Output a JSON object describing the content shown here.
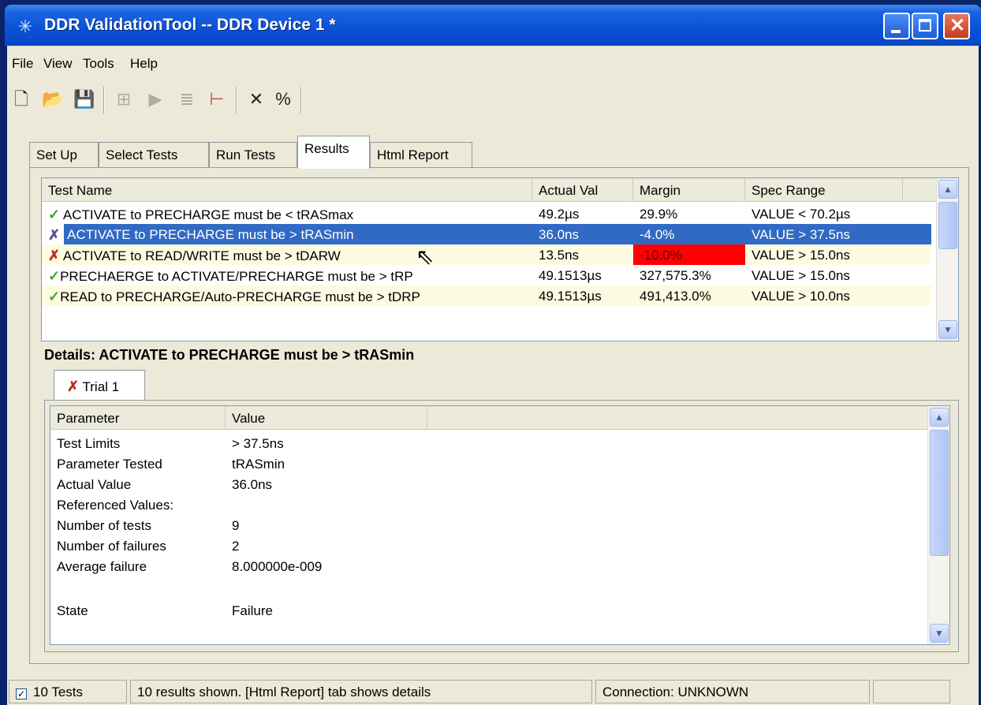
{
  "window": {
    "title": "DDR ValidationTool -- DDR Device 1 *",
    "icon": "app-sparkle-icon"
  },
  "menu": [
    "File",
    "View",
    "Tools",
    "Help"
  ],
  "toolbar": [
    "new-icon",
    "open-icon",
    "save-icon",
    "connect-icon",
    "run-icon",
    "step-icon",
    "marker-icon",
    "delete-icon",
    "percent-icon"
  ],
  "tabs": [
    {
      "label": "Set Up"
    },
    {
      "label": "Select Tests"
    },
    {
      "label": "Run Tests"
    },
    {
      "label": "Results",
      "active": true
    },
    {
      "label": "Html Report"
    }
  ],
  "results": {
    "columns": [
      "Test Name",
      "Actual Val",
      "Margin",
      "Spec Range"
    ],
    "rows": [
      {
        "status": "pass",
        "name": "ACTIVATE to PRECHARGE must be < tRASmax",
        "actual": "49.2µs",
        "margin": "29.9%",
        "spec": "VALUE < 70.2µs"
      },
      {
        "status": "fail",
        "name": "ACTIVATE to PRECHARGE must be > tRASmin",
        "actual": "36.0ns",
        "margin": "-4.0%",
        "spec": "VALUE > 37.5ns",
        "selected": true
      },
      {
        "status": "fail",
        "name": "ACTIVATE to READ/WRITE must be > tDARW",
        "actual": "13.5ns",
        "margin": "-10.0%",
        "spec": "VALUE > 15.0ns",
        "margin_highlight": true
      },
      {
        "status": "pass",
        "name": "PRECHAERGE to ACTIVATE/PRECHARGE must be > tRP",
        "actual": "49.1513µs",
        "margin": "327,575.3%",
        "spec": "VALUE > 15.0ns"
      },
      {
        "status": "pass",
        "name": "READ to PRECHARGE/Auto-PRECHARGE must be > tDRP",
        "actual": "49.1513µs",
        "margin": "491,413.0%",
        "spec": "VALUE > 10.0ns"
      }
    ]
  },
  "details": {
    "title": "Details: ACTIVATE to PRECHARGE must be > tRASmin",
    "trial_tab": "Trial 1",
    "columns": [
      "Parameter",
      "Value"
    ],
    "params": [
      {
        "name": "Test Limits",
        "value": "> 37.5ns"
      },
      {
        "name": "Parameter Tested",
        "value": "tRASmin"
      },
      {
        "name": "Actual Value",
        "value": "36.0ns"
      },
      {
        "name": "Referenced Values:",
        "value": ""
      },
      {
        "name": "Number of tests",
        "value": "9"
      },
      {
        "name": "Number of failures",
        "value": "2"
      },
      {
        "name": "Average failure",
        "value": "8.000000e-009"
      },
      {
        "name": "",
        "value": ""
      },
      {
        "name": "State",
        "value": "Failure"
      }
    ]
  },
  "status": {
    "tests": "10 Tests",
    "message": "10 results shown. [Html Report] tab shows details",
    "connection": "Connection: UNKNOWN"
  },
  "colors": {
    "selection": "#316ac5",
    "fail_highlight": "#ff0000",
    "titlebar": "#0a51d6"
  }
}
